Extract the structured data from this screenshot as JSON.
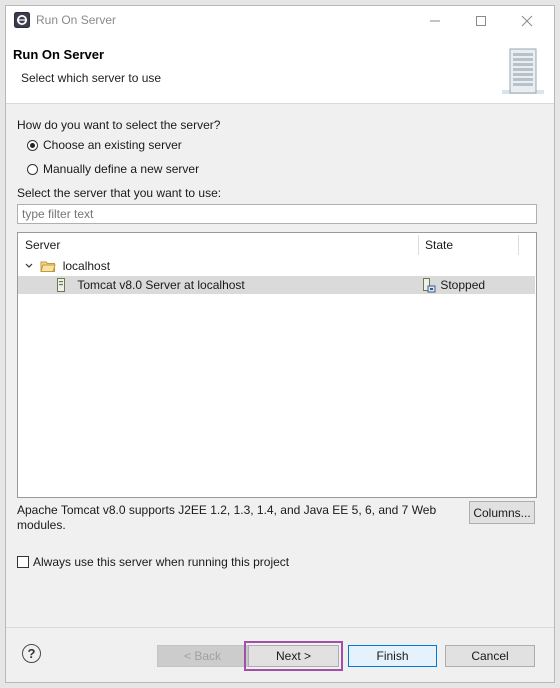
{
  "window": {
    "title": "Run On Server",
    "controls": [
      "minimize",
      "maximize",
      "close"
    ]
  },
  "banner": {
    "title": "Run On Server",
    "subtitle": "Select which server to use",
    "icon": "server-tower-icon"
  },
  "selection": {
    "question": "How do you want to select the server?",
    "options": [
      {
        "label": "Choose an existing server",
        "selected": true
      },
      {
        "label": "Manually define a new server",
        "selected": false
      }
    ]
  },
  "server_list": {
    "prompt": "Select the server that you want to use:",
    "filter_placeholder": "type filter text",
    "columns": [
      "Server",
      "State"
    ],
    "groups": [
      {
        "label": "localhost",
        "expanded": true,
        "icon": "folder-open-icon",
        "items": [
          {
            "name": "Tomcat v8.0 Server at localhost",
            "state": "Stopped",
            "selected": true,
            "icon": "server-icon",
            "state_icon": "server-stopped-icon"
          }
        ]
      }
    ]
  },
  "description": "Apache Tomcat v8.0 supports J2EE 1.2, 1.3, 1.4, and Java EE 5, 6, and 7 Web modules.",
  "columns_button": "Columns...",
  "always_use": {
    "label": "Always use this server when running this project",
    "checked": false
  },
  "buttons": {
    "back": "< Back",
    "next": "Next >",
    "finish": "Finish",
    "cancel": "Cancel",
    "help": "?"
  },
  "colors": {
    "highlight_outline": "#a24fa8",
    "primary_border": "#0078d7"
  }
}
